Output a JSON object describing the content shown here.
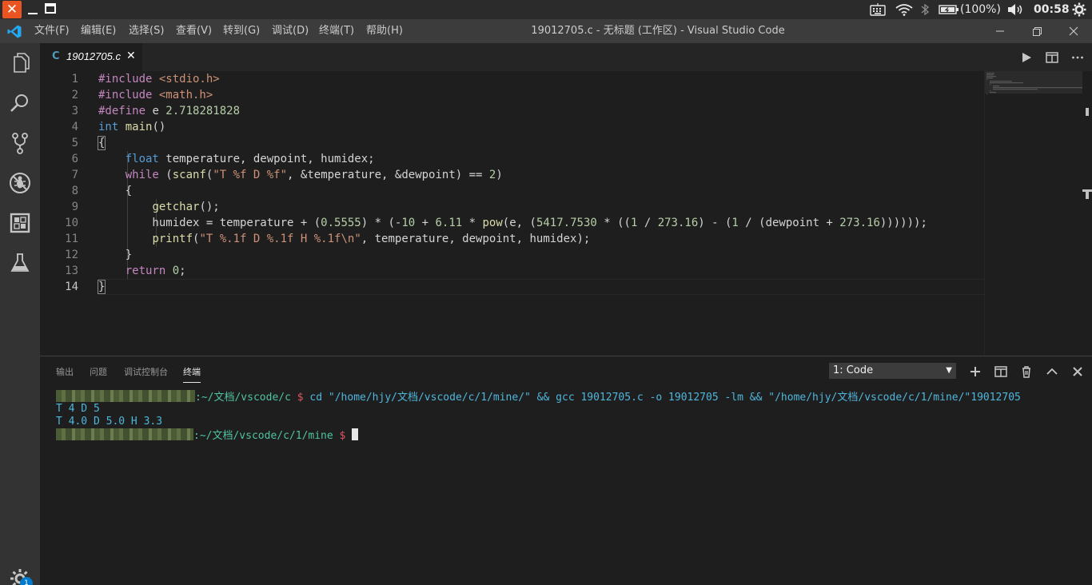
{
  "os": {
    "close_glyph": "✕",
    "battery": "(100%)",
    "clock": "00:58"
  },
  "menubar": {
    "items": [
      "文件(F)",
      "编辑(E)",
      "选择(S)",
      "查看(V)",
      "转到(G)",
      "调试(D)",
      "终端(T)",
      "帮助(H)"
    ],
    "window_title": "19012705.c - 无标题 (工作区) - Visual Studio Code"
  },
  "activity": {
    "icons": [
      "files-icon",
      "search-icon",
      "source-control-icon",
      "debug-icon",
      "extensions-icon",
      "test-flask-icon",
      "settings-gear-icon"
    ],
    "settings_badge": "1"
  },
  "tab": {
    "icon_glyph": "C",
    "filename": "19012705.c",
    "close_glyph": "✕"
  },
  "editor": {
    "line_numbers": [
      "1",
      "2",
      "3",
      "4",
      "5",
      "6",
      "7",
      "8",
      "9",
      "10",
      "11",
      "12",
      "13",
      "14"
    ],
    "active_line": 14,
    "lines": [
      [
        [
          "pp",
          "#include "
        ],
        [
          "str",
          "<stdio.h>"
        ]
      ],
      [
        [
          "pp",
          "#include "
        ],
        [
          "str",
          "<math.h>"
        ]
      ],
      [
        [
          "pp",
          "#define "
        ],
        [
          "pl",
          "e "
        ],
        [
          "num",
          "2.718281828"
        ]
      ],
      [
        [
          "kw",
          "int "
        ],
        [
          "fn",
          "main"
        ],
        [
          "pl",
          "()"
        ]
      ],
      [
        [
          "pl",
          "{"
        ]
      ],
      [
        [
          "pl",
          "    "
        ],
        [
          "kw",
          "float "
        ],
        [
          "pl",
          "temperature, dewpoint, humidex;"
        ]
      ],
      [
        [
          "pl",
          "    "
        ],
        [
          "ctl",
          "while "
        ],
        [
          "pl",
          "("
        ],
        [
          "fn",
          "scanf"
        ],
        [
          "pl",
          "("
        ],
        [
          "str",
          "\"T %f D %f\""
        ],
        [
          "pl",
          ", &temperature, &dewpoint) == "
        ],
        [
          "num",
          "2"
        ],
        [
          "pl",
          ")"
        ]
      ],
      [
        [
          "pl",
          "    {"
        ]
      ],
      [
        [
          "pl",
          "        "
        ],
        [
          "fn",
          "getchar"
        ],
        [
          "pl",
          "();"
        ]
      ],
      [
        [
          "pl",
          "        humidex = temperature + ("
        ],
        [
          "num",
          "0.5555"
        ],
        [
          "pl",
          ") * (-"
        ],
        [
          "num",
          "10"
        ],
        [
          "pl",
          " + "
        ],
        [
          "num",
          "6.11"
        ],
        [
          "pl",
          " * "
        ],
        [
          "fn",
          "pow"
        ],
        [
          "pl",
          "(e, ("
        ],
        [
          "num",
          "5417.7530"
        ],
        [
          "pl",
          " * (("
        ],
        [
          "num",
          "1"
        ],
        [
          "pl",
          " / "
        ],
        [
          "num",
          "273.16"
        ],
        [
          "pl",
          ") - ("
        ],
        [
          "num",
          "1"
        ],
        [
          "pl",
          " / (dewpoint + "
        ],
        [
          "num",
          "273.16"
        ],
        [
          "pl",
          "))))));"
        ]
      ],
      [
        [
          "pl",
          "        "
        ],
        [
          "fn",
          "printf"
        ],
        [
          "pl",
          "("
        ],
        [
          "str",
          "\"T %.1f D %.1f H %.1f\\n\""
        ],
        [
          "pl",
          ", temperature, dewpoint, humidex);"
        ]
      ],
      [
        [
          "pl",
          "    }"
        ]
      ],
      [
        [
          "pl",
          "    "
        ],
        [
          "ctl",
          "return "
        ],
        [
          "num",
          "0"
        ],
        [
          "pl",
          ";"
        ]
      ],
      [
        [
          "pl",
          "}"
        ]
      ]
    ]
  },
  "panel": {
    "tabs": [
      "输出",
      "问题",
      "调试控制台",
      "终端"
    ],
    "active_tab": "终端",
    "terminal_selector": "1: Code",
    "terminal": {
      "line1_path": ":~/文档/vscode/c",
      "line1_prompt": "$",
      "line1_cmd": "cd \"/home/hjy/文档/vscode/c/1/mine/\" && gcc 19012705.c -o 19012705 -lm && \"/home/hjy/文档/vscode/c/1/mine/\"19012705",
      "line2": "T 4 D 5",
      "line3": "T 4.0 D 5.0 H 3.3",
      "line4_path": ":~/文档/vscode/c/1/mine",
      "line4_prompt": "$"
    }
  },
  "colors": {
    "os_close": "#e95420",
    "terminal_text": "#4fb6dc",
    "terminal_prompt": "#e05561",
    "terminal_path": "#4fc3a1",
    "vscode_blue": "#23a9f2"
  }
}
